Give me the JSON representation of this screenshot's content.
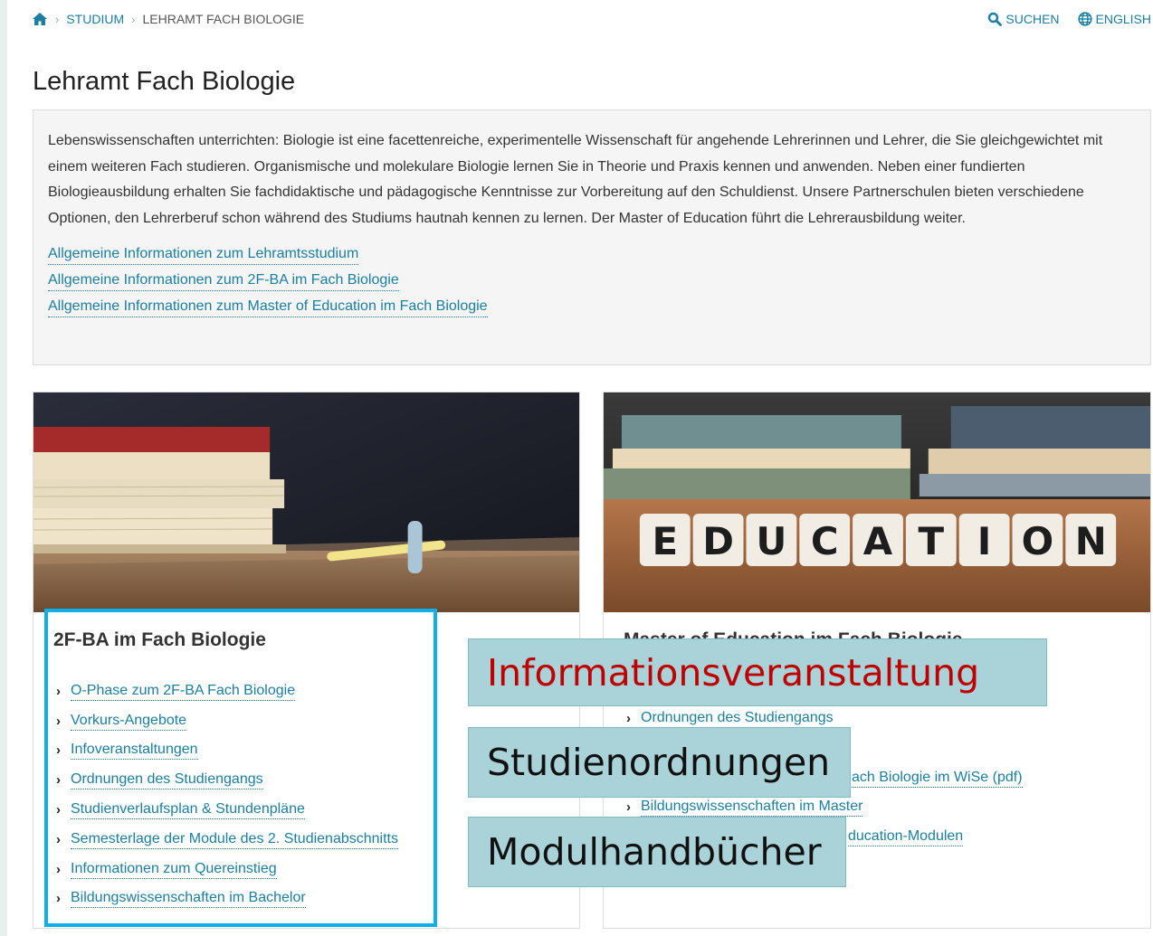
{
  "breadcrumb": {
    "home_icon": "home-icon",
    "items": [
      "STUDIUM",
      "LEHRAMT FACH BIOLOGIE"
    ]
  },
  "tools": {
    "search_label": "SUCHEN",
    "search_icon": "search-icon",
    "language_label": "ENGLISH",
    "language_icon": "globe-icon"
  },
  "page_title": "Lehramt Fach Biologie",
  "intro": {
    "text": "Lebenswissenschaften unterrichten: Biologie ist eine facettenreiche, experimentelle Wissenschaft für angehende Lehrerinnen und Lehrer, die Sie gleichgewichtet mit einem weiteren Fach studieren. Organismische und molekulare Biologie lernen Sie in Theorie und Praxis kennen und anwenden. Neben einer fundierten Biologieausbildung erhalten Sie fachdidaktische und pädagogische Kenntnisse zur Vorbereitung auf den Schuldienst. Unsere Partnerschulen bieten verschiedene Optionen, den Lehrerberuf schon während des Studiums hautnah kennen zu lernen. Der Master of Education führt die Lehrerausbildung weiter.",
    "links": [
      "Allgemeine Informationen zum Lehramtsstudium",
      "Allgemeine Informationen zum 2F-BA im Fach Biologie",
      "Allgemeine Informationen zum Master of Education im Fach Biologie"
    ]
  },
  "cards": {
    "left": {
      "title": "2F-BA im Fach Biologie",
      "links": [
        "O-Phase zum 2F-BA Fach Biologie",
        "Vorkurs-Angebote",
        "Infoveranstaltungen",
        "Ordnungen des Studiengangs",
        "Studienverlaufsplan & Stundenpläne",
        "Semesterlage der Module des 2. Studienabschnitts",
        "Informationen zum Quereinstieg",
        "Bildungswissenschaften im Bachelor"
      ]
    },
    "right": {
      "title": "Master of Education im Fach Biologie",
      "image_text": "EDUCATION",
      "links": [
        "Ordnungen des Studiengangs",
        "ach Biologie im WiSe (pdf)",
        "Bildungswissenschaften im Master",
        "ducation-Modulen"
      ]
    }
  },
  "overlays": {
    "info": "Informationsveranstaltung",
    "ordnungen": "Studienordnungen",
    "modul": "Modulhandbücher"
  },
  "colors": {
    "link": "#1a7fa0",
    "highlight_border": "#0fb0e8",
    "overlay_bg": "#a9d3d8",
    "overlay_red": "#c00000"
  }
}
